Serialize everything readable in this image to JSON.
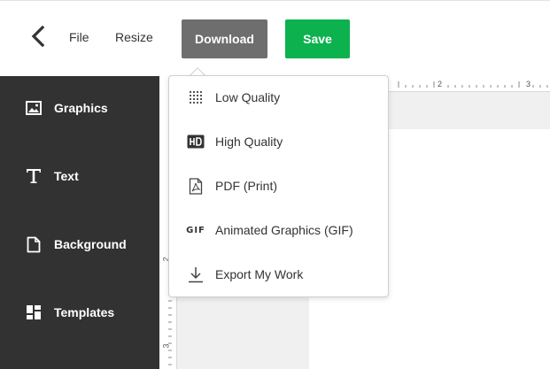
{
  "toolbar": {
    "file_label": "File",
    "resize_label": "Resize",
    "download_label": "Download",
    "save_label": "Save"
  },
  "colors": {
    "download_bg": "#6e6e6e",
    "save_bg": "#0bb24e",
    "sidebar_bg": "#323232"
  },
  "sidebar": {
    "items": [
      {
        "label": "Graphics",
        "icon": "image-icon"
      },
      {
        "label": "Text",
        "icon": "text-t-icon"
      },
      {
        "label": "Background",
        "icon": "document-icon"
      },
      {
        "label": "Templates",
        "icon": "templates-grid-icon"
      }
    ]
  },
  "download_menu": {
    "items": [
      {
        "label": "Low Quality",
        "icon": "dotted-grid-icon"
      },
      {
        "label": "High Quality",
        "icon": "hd-icon"
      },
      {
        "label": "PDF (Print)",
        "icon": "pdf-icon"
      },
      {
        "label": "Animated Graphics (GIF)",
        "icon": "gif-icon",
        "icon_text": "GIF"
      },
      {
        "label": "Export My Work",
        "icon": "download-arrow-icon"
      }
    ]
  },
  "ruler": {
    "top_numbers": [
      "2",
      "3"
    ],
    "left_numbers": [
      "2",
      "3"
    ]
  }
}
